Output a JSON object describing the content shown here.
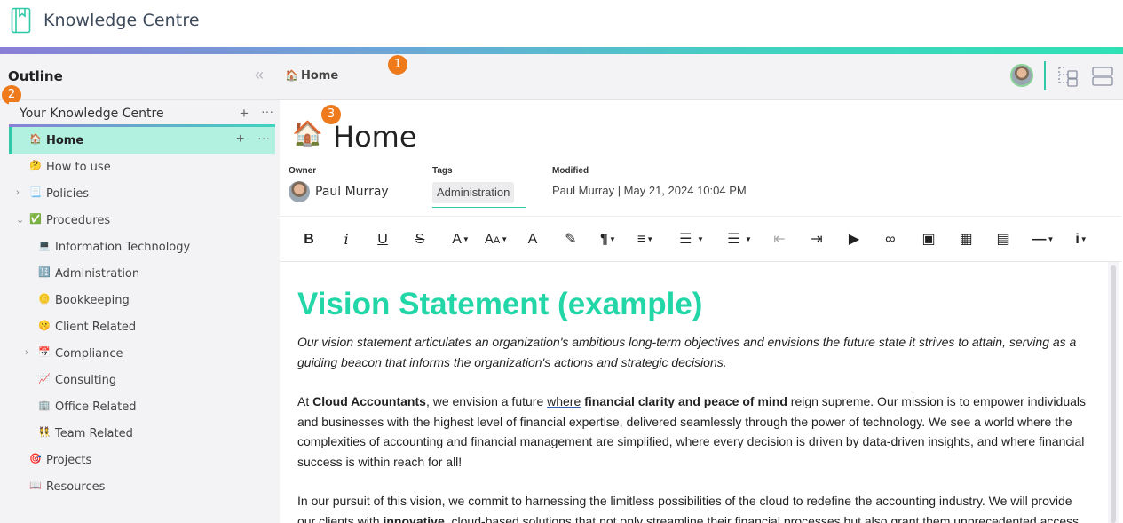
{
  "app": {
    "title": "Knowledge Centre"
  },
  "colors": {
    "accent": "#2ec9a6",
    "badge": "#ee7a1c",
    "heading": "#22d6a7"
  },
  "badges": {
    "b1": "1",
    "b2": "2",
    "b3": "3"
  },
  "outline": {
    "title": "Outline",
    "root_label": "Your Knowledge Centre",
    "items": [
      {
        "label": "Home",
        "emoji": "🏠",
        "level": 0,
        "chevron": "",
        "active": true
      },
      {
        "label": "How to use",
        "emoji": "🤔",
        "level": 0,
        "chevron": ""
      },
      {
        "label": "Policies",
        "emoji": "📃",
        "level": 0,
        "chevron": "›"
      },
      {
        "label": "Procedures",
        "emoji": "✅",
        "level": 0,
        "chevron": "⌄"
      },
      {
        "label": "Information Technology",
        "emoji": "💻",
        "level": 1,
        "chevron": ""
      },
      {
        "label": "Administration",
        "emoji": "🔢",
        "level": 1,
        "chevron": ""
      },
      {
        "label": "Bookkeeping",
        "emoji": "🪙",
        "level": 1,
        "chevron": ""
      },
      {
        "label": "Client Related",
        "emoji": "🤫",
        "level": 1,
        "chevron": ""
      },
      {
        "label": "Compliance",
        "emoji": "📅",
        "level": 1,
        "chevron": "›"
      },
      {
        "label": "Consulting",
        "emoji": "📈",
        "level": 1,
        "chevron": ""
      },
      {
        "label": "Office Related",
        "emoji": "🏢",
        "level": 1,
        "chevron": ""
      },
      {
        "label": "Team Related",
        "emoji": "👯",
        "level": 1,
        "chevron": ""
      },
      {
        "label": "Projects",
        "emoji": "🎯",
        "level": 0,
        "chevron": ""
      },
      {
        "label": "Resources",
        "emoji": "📖",
        "level": 0,
        "chevron": ""
      }
    ]
  },
  "breadcrumb": {
    "emoji": "🏠",
    "label": "Home"
  },
  "page": {
    "emoji": "🏠",
    "title": "Home",
    "owner_label": "Owner",
    "owner_name": "Paul Murray",
    "tags_label": "Tags",
    "tag": "Administration",
    "modified_label": "Modified",
    "modified_value": "Paul Murray | May 21, 2024 10:04 PM"
  },
  "toolbar": {
    "buttons": [
      {
        "name": "bold-button",
        "glyph": "B"
      },
      {
        "name": "italic-button",
        "glyph": "i"
      },
      {
        "name": "underline-button",
        "glyph": "U"
      },
      {
        "name": "strikethrough-button",
        "glyph": "S"
      },
      {
        "name": "font-size-button",
        "glyph": "A"
      },
      {
        "name": "text-case-button",
        "glyph": "AA"
      },
      {
        "name": "font-color-button",
        "glyph": "A"
      },
      {
        "name": "highlight-button",
        "glyph": "✎"
      },
      {
        "name": "paragraph-style-button",
        "glyph": "¶"
      },
      {
        "name": "align-button",
        "glyph": "≡"
      },
      {
        "name": "numbered-list-button",
        "glyph": "☰"
      },
      {
        "name": "bullet-list-button",
        "glyph": "☰"
      },
      {
        "name": "outdent-button",
        "glyph": "⇤"
      },
      {
        "name": "indent-button",
        "glyph": "⇥"
      },
      {
        "name": "video-button",
        "glyph": "▶"
      },
      {
        "name": "link-button",
        "glyph": "∞"
      },
      {
        "name": "image-button",
        "glyph": "▣"
      },
      {
        "name": "table-button",
        "glyph": "▦"
      },
      {
        "name": "pdf-button",
        "glyph": "▤"
      },
      {
        "name": "horizontal-rule-button",
        "glyph": "—"
      },
      {
        "name": "info-button",
        "glyph": "i"
      }
    ]
  },
  "doc": {
    "heading": "Vision Statement (example)",
    "intro": "Our vision statement articulates an organization's ambitious long-term objectives and envisions the future state it strives to attain, serving as a guiding beacon that informs the organization's actions and strategic decisions.",
    "p1_a": "At ",
    "p1_b": "Cloud Accountants",
    "p1_c": ", we envision a future ",
    "p1_d": "where",
    "p1_e": " ",
    "p1_f": "financial clarity and peace of mind",
    "p1_g": " reign supreme. Our mission is to empower individuals and businesses with the highest level of financial expertise, delivered seamlessly through the power of technology. We see a world where the complexities of accounting and financial management are simplified, where every decision is driven by data-driven insights, and where financial success is within reach for all!",
    "p2_a": "In our pursuit of this vision, we commit to harnessing the limitless possibilities of the cloud to redefine the accounting industry. We will provide our clients with ",
    "p2_b": "innovative",
    "p2_c": ", cloud-based solutions that not only streamline their financial processes but also grant them unprecedented access"
  }
}
